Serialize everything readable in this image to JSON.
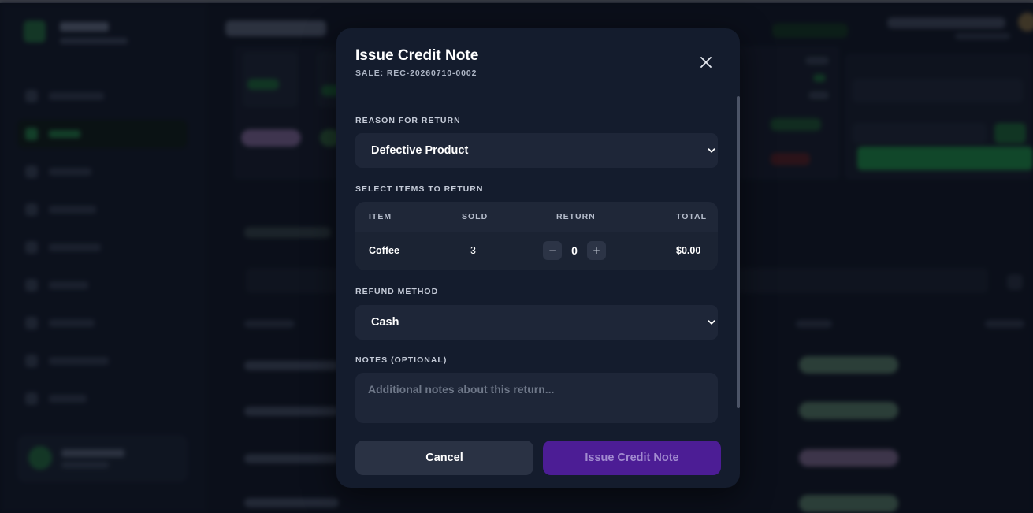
{
  "modal": {
    "title": "Issue Credit Note",
    "subtitle": "SALE: REC-20260710-0002",
    "close_icon": "close-icon",
    "reason": {
      "label": "REASON FOR RETURN",
      "selected": "Defective Product"
    },
    "items": {
      "label": "SELECT ITEMS TO RETURN",
      "columns": [
        "ITEM",
        "SOLD",
        "RETURN",
        "TOTAL"
      ],
      "rows": [
        {
          "item": "Coffee",
          "sold": "3",
          "return_qty": "0",
          "total": "$0.00"
        }
      ]
    },
    "refund": {
      "label": "REFUND METHOD",
      "selected": "Cash"
    },
    "notes": {
      "label": "NOTES (OPTIONAL)",
      "placeholder": "Additional notes about this return...",
      "value": ""
    },
    "buttons": {
      "cancel": "Cancel",
      "issue": "Issue Credit Note"
    }
  },
  "colors": {
    "modal_bg": "#141c2d",
    "field_bg": "#1e2638",
    "primary_disabled": "#4c1d95",
    "accent_green": "#1f8a4a"
  }
}
